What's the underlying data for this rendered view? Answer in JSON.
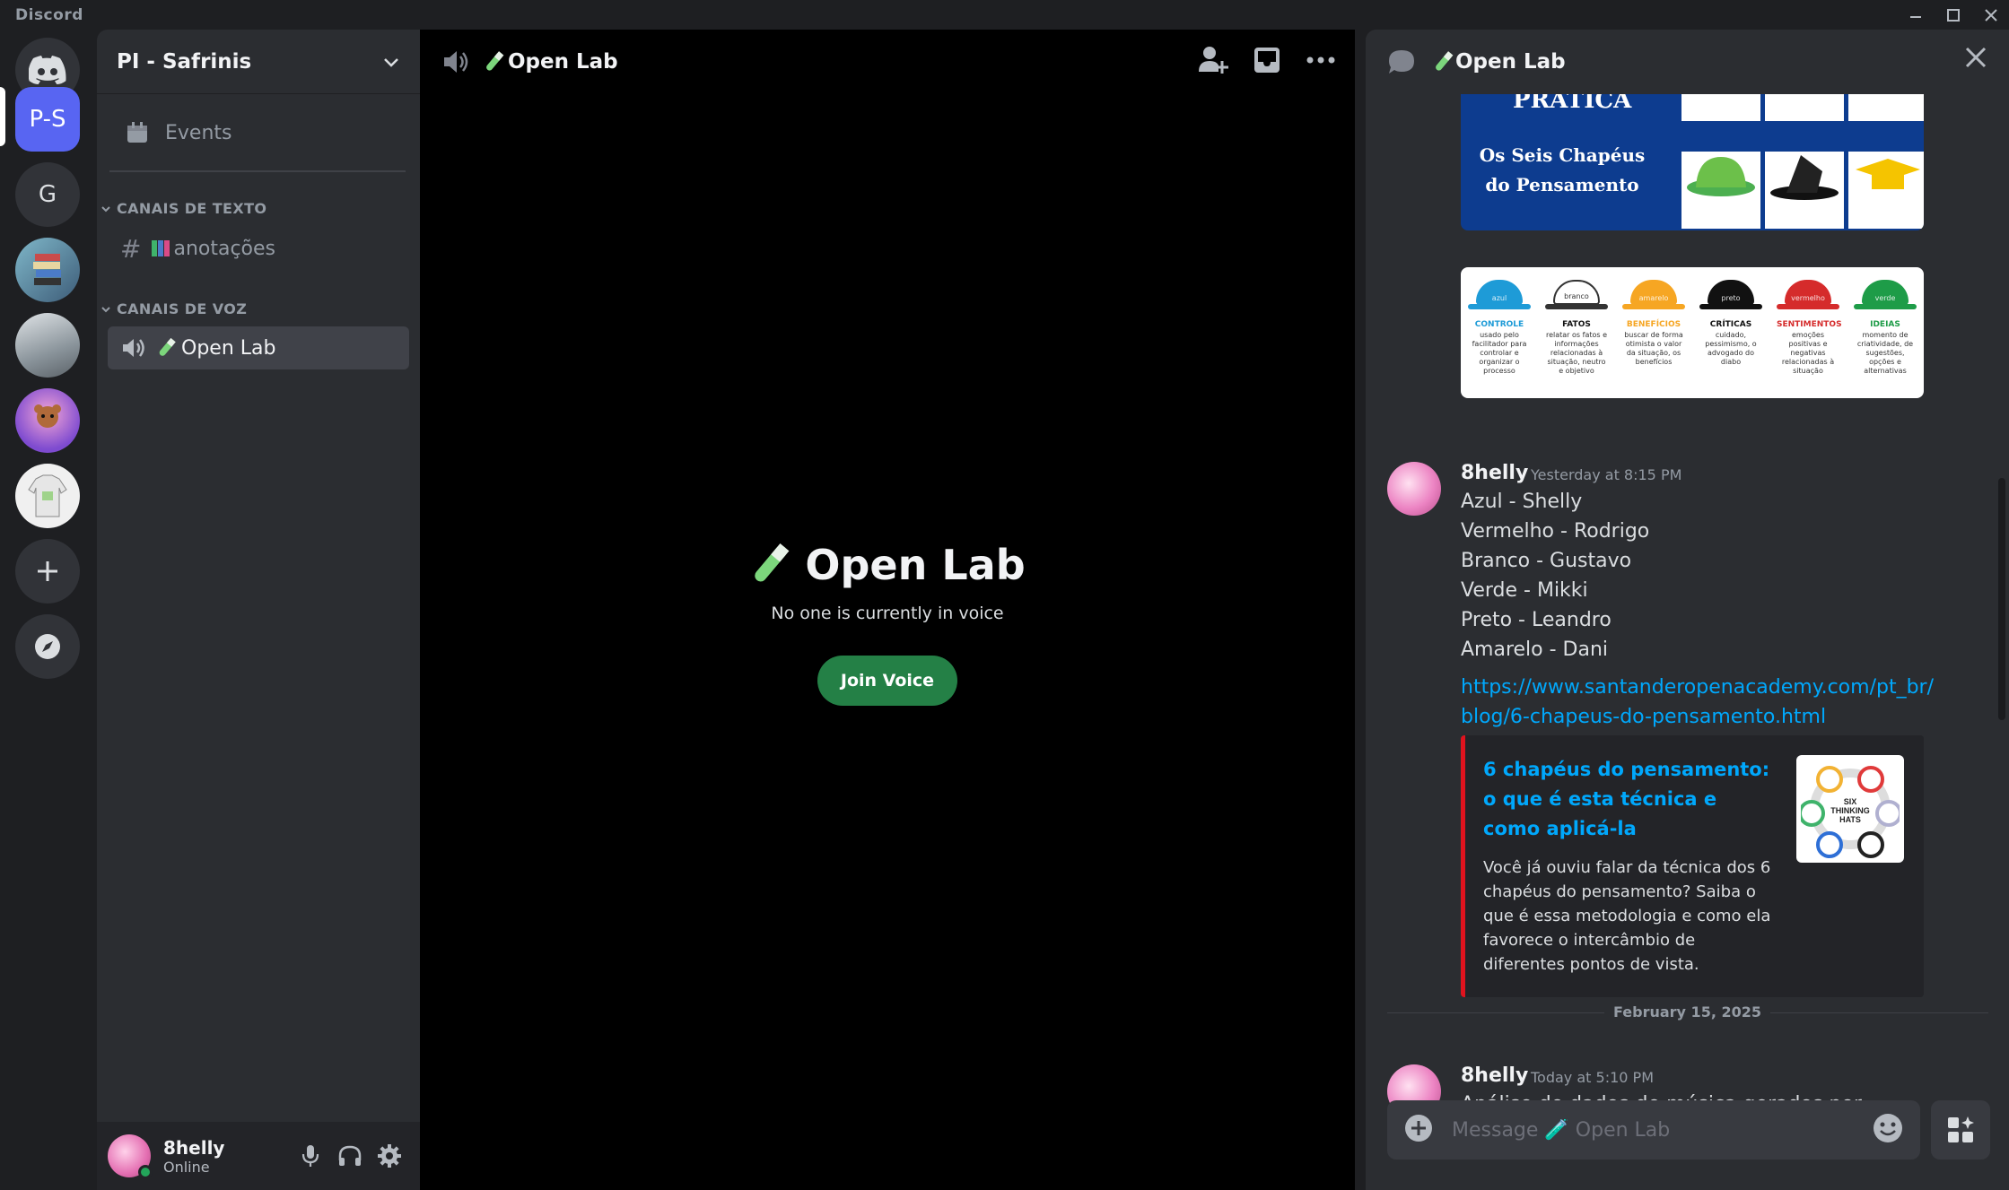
{
  "titlebar": {
    "brand": "Discord"
  },
  "rail": {
    "servers": [
      {
        "label": "P-S"
      },
      {
        "label": "G"
      }
    ]
  },
  "sidebar": {
    "guild_name": "PI - Safrinis",
    "events_label": "Events",
    "text_category": "CANAIS DE TEXTO",
    "text_channel": "anotações",
    "voice_category": "CANAIS DE VOZ",
    "voice_channel": "Open Lab"
  },
  "user": {
    "name": "8helly",
    "status": "Online"
  },
  "voice": {
    "title": "Open Lab",
    "heading": "Open Lab",
    "subtitle": "No one is currently in voice",
    "join_label": "Join Voice"
  },
  "panel": {
    "title": "Open Lab",
    "image1": {
      "heading": "PRÁTICA",
      "title": "Os Seis Chapéus do Pensamento"
    },
    "image2": {
      "hats": [
        {
          "color_name": "azul",
          "name": "CONTROLE",
          "desc": "usado pelo facilitador para controlar e organizar o processo",
          "color": "#1e9bd7"
        },
        {
          "color_name": "branco",
          "name": "FATOS",
          "desc": "relatar os fatos e informações relacionadas à situação, neutro e objetivo",
          "color": "#ffffff"
        },
        {
          "color_name": "amarelo",
          "name": "BENEFÍCIOS",
          "desc": "buscar de forma otimista o valor da situação, os benefícios",
          "color": "#f6a623"
        },
        {
          "color_name": "preto",
          "name": "CRÍTICAS",
          "desc": "cuidado, pessimismo, o advogado do diabo",
          "color": "#111111"
        },
        {
          "color_name": "vermelho",
          "name": "SENTIMENTOS",
          "desc": "emoções positivas e negativas relacionadas à situação",
          "color": "#d52b2b"
        },
        {
          "color_name": "verde",
          "name": "IDEIAS",
          "desc": "momento de criatividade, de sugestões, opções e alternativas",
          "color": "#1e9c48"
        }
      ]
    },
    "msg1": {
      "author": "8helly",
      "time": "Yesterday at 8:15 PM",
      "lines": [
        "Azul - Shelly",
        "Vermelho - Rodrigo",
        "Branco - Gustavo",
        "Verde - Mikki",
        "Preto - Leandro",
        "Amarelo - Dani"
      ],
      "link": "https://www.santanderopenacademy.com/pt_br/blog/6-chapeus-do-pensamento.html",
      "embed": {
        "title": "6 chapéus do pensamento: o que é esta técnica e como aplicá-la",
        "description": "Você já ouviu falar da técnica dos 6 chapéus do pensamento? Saiba o que é essa metodologia e como ela favorece o intercâmbio de diferentes pontos de vista.",
        "thumb_text": "SIX THINKING HATS"
      }
    },
    "date_divider": "February 15, 2025",
    "msg2": {
      "author": "8helly",
      "time": "Today at 5:10 PM",
      "text": "Análise de dados de música gerados por"
    },
    "composer_placeholder": "Message 🧪 Open Lab"
  }
}
